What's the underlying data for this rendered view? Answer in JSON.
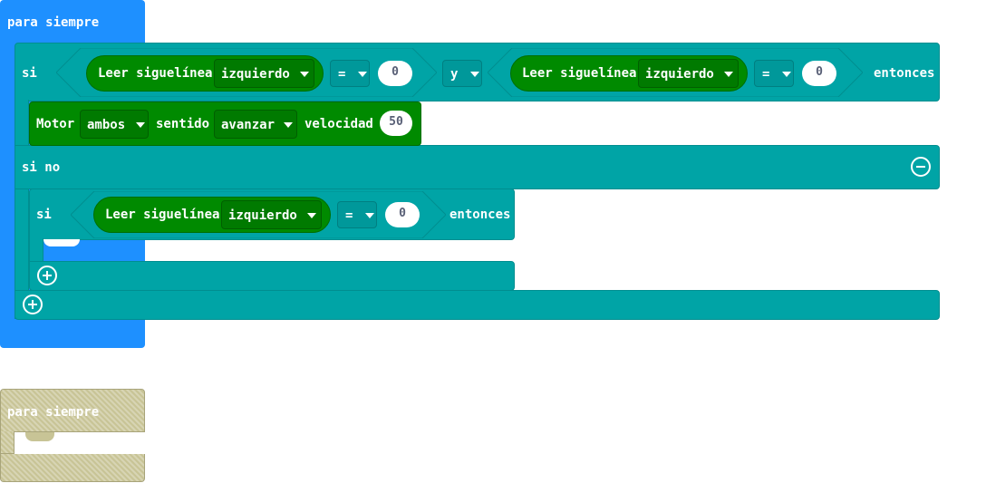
{
  "block1": {
    "label": "para siempre",
    "if_block": {
      "si_label": "si",
      "then_label": "entonces",
      "cond_left": {
        "label": "Leer siguelínea",
        "dropdown": "izquierdo",
        "op": "=",
        "value": "0"
      },
      "logic_op": "y",
      "cond_right": {
        "label": "Leer siguelínea",
        "dropdown": "izquierdo",
        "op": "=",
        "value": "0"
      },
      "motor": {
        "label": "Motor",
        "which": "ambos",
        "dir_label": "sentido",
        "dir": "avanzar",
        "speed_label": "velocidad",
        "speed": "50"
      },
      "else_label": "si no",
      "nested_if": {
        "si_label": "si",
        "then_label": "entonces",
        "cond": {
          "label": "Leer siguelínea",
          "dropdown": "izquierdo",
          "op": "=",
          "value": "0"
        }
      }
    }
  },
  "block2": {
    "label": "para siempre",
    "disabled": true
  },
  "colors": {
    "loops": "#1e90ff",
    "logic": "#00a4a6",
    "sensor": "#008a00",
    "disabled": "#c8c496"
  },
  "icons": {
    "minus": "minus-circle-icon",
    "plus": "plus-circle-icon",
    "dropdown": "dropdown-arrow-icon"
  }
}
